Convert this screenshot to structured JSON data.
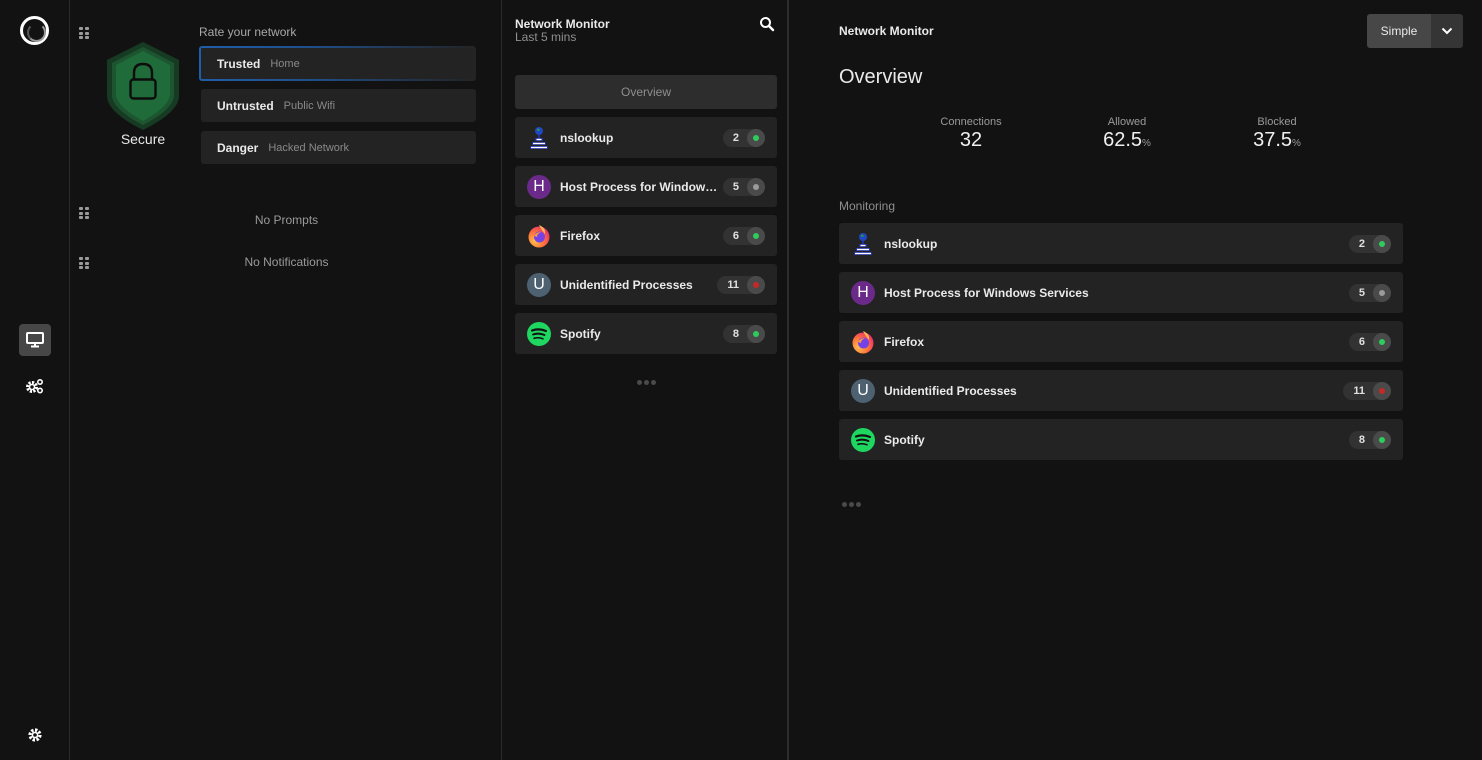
{
  "rail": {
    "logo": "portmaster-logo-icon",
    "items": [
      {
        "icon": "monitor-icon",
        "active": true
      },
      {
        "icon": "gears-icon",
        "active": false
      }
    ],
    "bottom_icon": "settings-gear-icon"
  },
  "security": {
    "status": "Secure",
    "status_color": "#1f6b3a",
    "rate_label": "Rate your network",
    "options": [
      {
        "name": "Trusted",
        "desc": "Home",
        "selected": true
      },
      {
        "name": "Untrusted",
        "desc": "Public Wifi",
        "selected": false
      },
      {
        "name": "Danger",
        "desc": "Hacked Network",
        "selected": false
      }
    ]
  },
  "prompts": {
    "empty_text": "No Prompts"
  },
  "notifications": {
    "empty_text": "No Notifications"
  },
  "monitor_panel": {
    "title": "Network Monitor",
    "subtitle": "Last 5 mins",
    "overview_button": "Overview",
    "processes": [
      {
        "name": "nslookup",
        "icon": "nslookup-globe-icon",
        "count": "2",
        "status_color": "#2ecc5a"
      },
      {
        "name": "Host Process for Windows ...",
        "icon_letter": "H",
        "icon_color": "#6b2a8a",
        "count": "5",
        "status_color": "#9a9a9a"
      },
      {
        "name": "Firefox",
        "icon": "firefox-icon",
        "count": "6",
        "status_color": "#2ecc5a"
      },
      {
        "name": "Unidentified Processes",
        "icon_letter": "U",
        "icon_color": "#4d6170",
        "count": "11",
        "status_color": "#c62828"
      },
      {
        "name": "Spotify",
        "icon": "spotify-icon",
        "count": "8",
        "status_color": "#2ecc5a"
      }
    ]
  },
  "overview": {
    "app_title": "Network Monitor",
    "mode": "Simple",
    "heading": "Overview",
    "stats": [
      {
        "label": "Connections",
        "value": "32",
        "unit": ""
      },
      {
        "label": "Allowed",
        "value": "62.5",
        "unit": "%"
      },
      {
        "label": "Blocked",
        "value": "37.5",
        "unit": "%"
      }
    ],
    "monitoring_label": "Monitoring",
    "processes": [
      {
        "name": "nslookup",
        "count": "2",
        "status_color": "#2ecc5a"
      },
      {
        "name": "Host Process for Windows Services",
        "icon_letter": "H",
        "count": "5",
        "status_color": "#9a9a9a"
      },
      {
        "name": "Firefox",
        "count": "6",
        "status_color": "#2ecc5a"
      },
      {
        "name": "Unidentified Processes",
        "icon_letter": "U",
        "count": "11",
        "status_color": "#c62828"
      },
      {
        "name": "Spotify",
        "count": "8",
        "status_color": "#2ecc5a"
      }
    ]
  }
}
